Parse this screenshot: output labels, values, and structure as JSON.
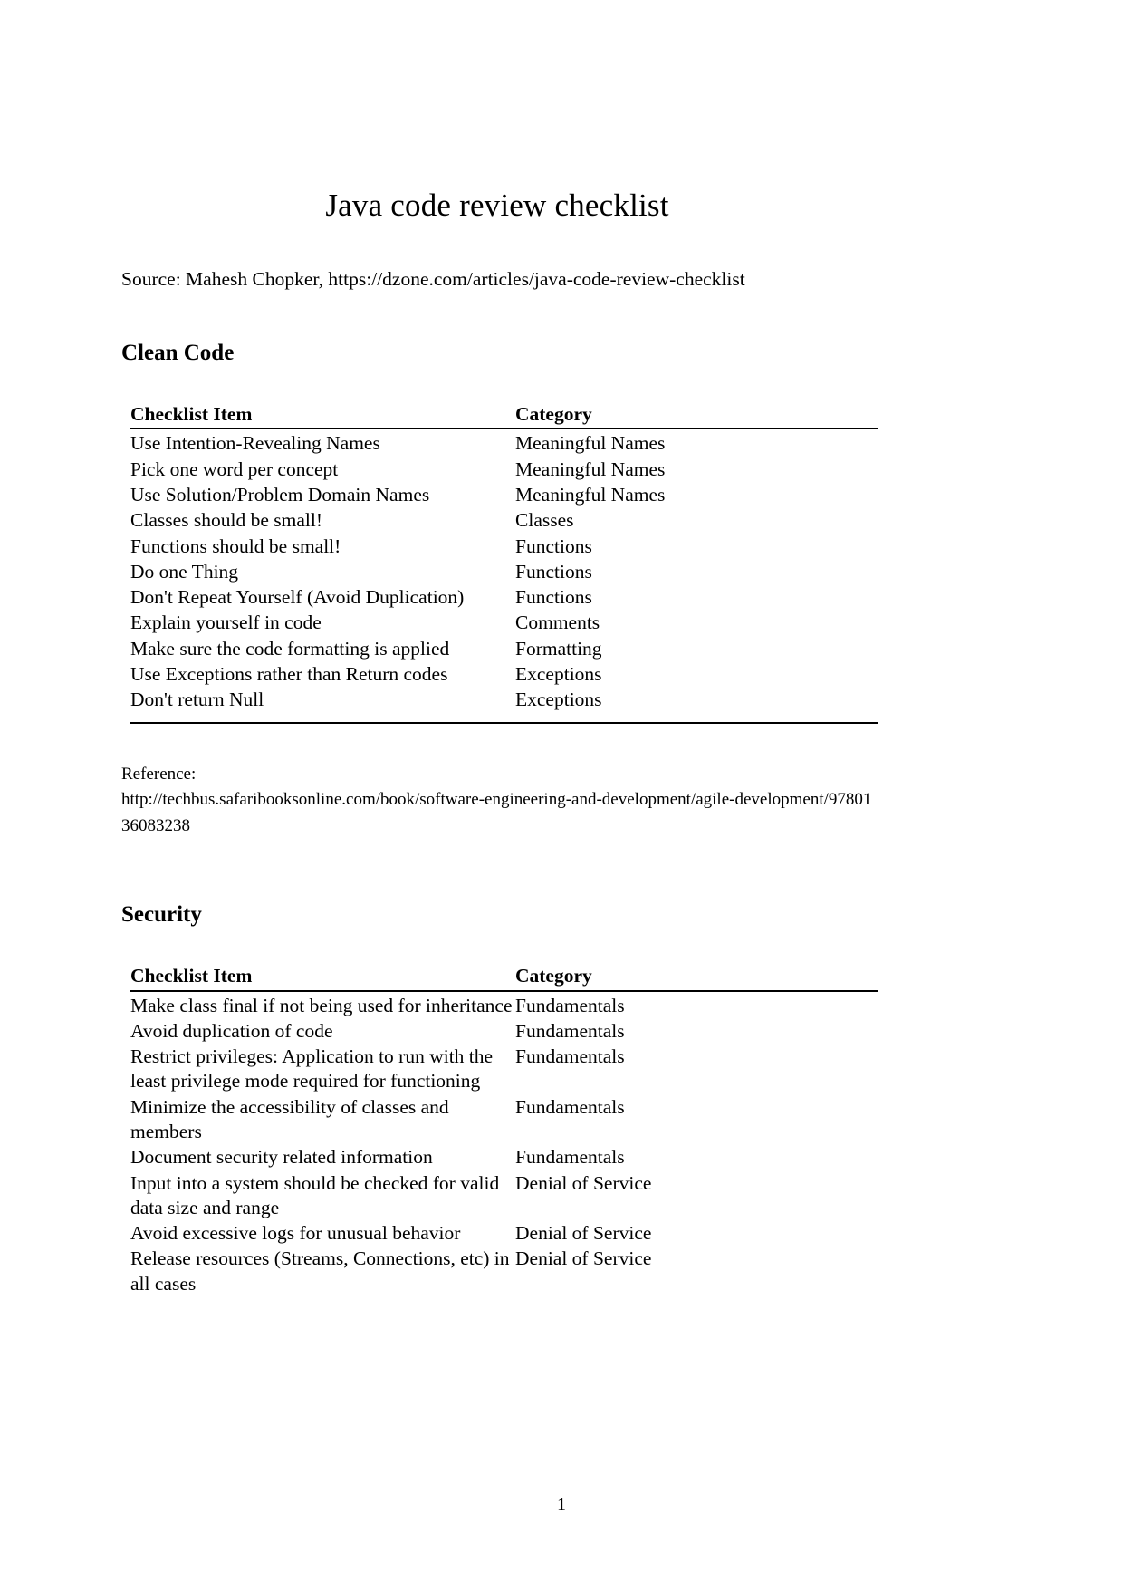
{
  "document": {
    "title": "Java code review checklist",
    "source_line": "Source: Mahesh Chopker, https://dzone.com/articles/java-code-review-checklist",
    "page_number": "1"
  },
  "sections": [
    {
      "heading": "Clean Code",
      "table": {
        "columns": [
          "Checklist Item",
          "Category"
        ],
        "rows": [
          [
            "Use Intention-Revealing Names",
            "Meaningful Names"
          ],
          [
            "Pick one word per concept",
            "Meaningful Names"
          ],
          [
            "Use Solution/Problem Domain Names",
            "Meaningful Names"
          ],
          [
            "Classes should be small!",
            "Classes"
          ],
          [
            "Functions should be small!",
            "Functions"
          ],
          [
            "Do one Thing",
            "Functions"
          ],
          [
            "Don't Repeat Yourself (Avoid Duplication)",
            "Functions"
          ],
          [
            "Explain yourself in code",
            "Comments"
          ],
          [
            "Make sure the code formatting is applied",
            "Formatting"
          ],
          [
            "Use Exceptions rather than Return codes",
            "Exceptions"
          ],
          [
            "Don't return Null",
            "Exceptions"
          ]
        ]
      },
      "reference": {
        "label": "Reference:",
        "url": "http://techbus.safaribooksonline.com/book/software-engineering-and-development/agile-development/9780136083238"
      }
    },
    {
      "heading": "Security",
      "table": {
        "columns": [
          "Checklist Item",
          "Category"
        ],
        "rows": [
          [
            "Make class final if not being used for inheritance",
            "Fundamentals"
          ],
          [
            "Avoid duplication of code",
            "Fundamentals"
          ],
          [
            "Restrict privileges: Application to run with the least privilege mode required for functioning",
            "Fundamentals"
          ],
          [
            "Minimize the accessibility of classes and members",
            "Fundamentals"
          ],
          [
            "Document security related information",
            "Fundamentals"
          ],
          [
            "Input into a system should be checked for valid data size and range",
            "Denial of Service"
          ],
          [
            "Avoid excessive logs for unusual behavior",
            "Denial of Service"
          ],
          [
            "Release resources (Streams, Connections, etc) in all cases",
            "Denial of Service"
          ]
        ]
      }
    }
  ]
}
